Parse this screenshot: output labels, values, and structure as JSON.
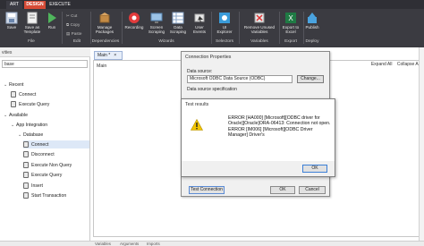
{
  "tabs": {
    "start": "ART",
    "design": "DESIGN",
    "execute": "EXECUTE"
  },
  "ribbon": {
    "save": "Save",
    "save_as_template": "Save as Template",
    "run": "Run",
    "cut": "Cut",
    "copy": "Copy",
    "paste": "Paste",
    "manage_packages": "Manage Packages",
    "recording": "Recording",
    "screen_scraping": "Screen Scraping",
    "data_scraping": "Data Scraping",
    "user_events": "User Events",
    "ui_explorer": "UI Explorer",
    "remove_unused_variables": "Remove Unused Variables",
    "export_to_excel": "Export to Excel",
    "publish": "Publish",
    "groups": {
      "file": "File",
      "edit": "Edit",
      "dependencies": "Dependencies",
      "wizards": "Wizards",
      "selectors": "Selectors",
      "variables": "Variables",
      "export": "Export",
      "deploy": "Deploy"
    }
  },
  "left_panel": {
    "title": "vities",
    "search_value": "base",
    "recent": "Recent",
    "recent_items": [
      "Connect",
      "Execute Query"
    ],
    "available": "Available",
    "app_integration": "App Integration",
    "database": "Database",
    "database_items": [
      "Connect",
      "Disconnect",
      "Execute Non Query",
      "Execute Query",
      "Insert",
      "Start Transaction"
    ]
  },
  "main": {
    "doc_tab": "Main *",
    "label": "Main",
    "expand_all": "Expand All",
    "collapse_all": "Collapse All"
  },
  "conn_props": {
    "title": "Connection Properties",
    "data_source_label": "Data source:",
    "data_source_value": "Microsoft ODBC Data Source (ODBC)",
    "change_button": "Change...",
    "spec_label": "Data source specification",
    "test_connection": "Test Connection",
    "ok": "OK",
    "cancel": "Cancel"
  },
  "test_results": {
    "title": "Test results",
    "message_lines": [
      "ERROR [HA000] [Microsoft][ODBC driver for",
      "Oracle][Oracle]ORA-06413: Connection not open.",
      "ERROR [IM006] [Microsoft][ODBC Driver Manager] Driver's"
    ],
    "ok": "OK"
  },
  "bottom": {
    "a": "Variables",
    "b": "Arguments",
    "c": "Imports"
  },
  "icons": {
    "warning": "warning-icon",
    "save": "save-icon",
    "run": "play-icon",
    "record": "record-icon"
  },
  "colors": {
    "design_tab": "#d64b36",
    "ribbon_bg": "#3b3b41",
    "selection": "#dde8f7",
    "warning": "#f2c500"
  }
}
